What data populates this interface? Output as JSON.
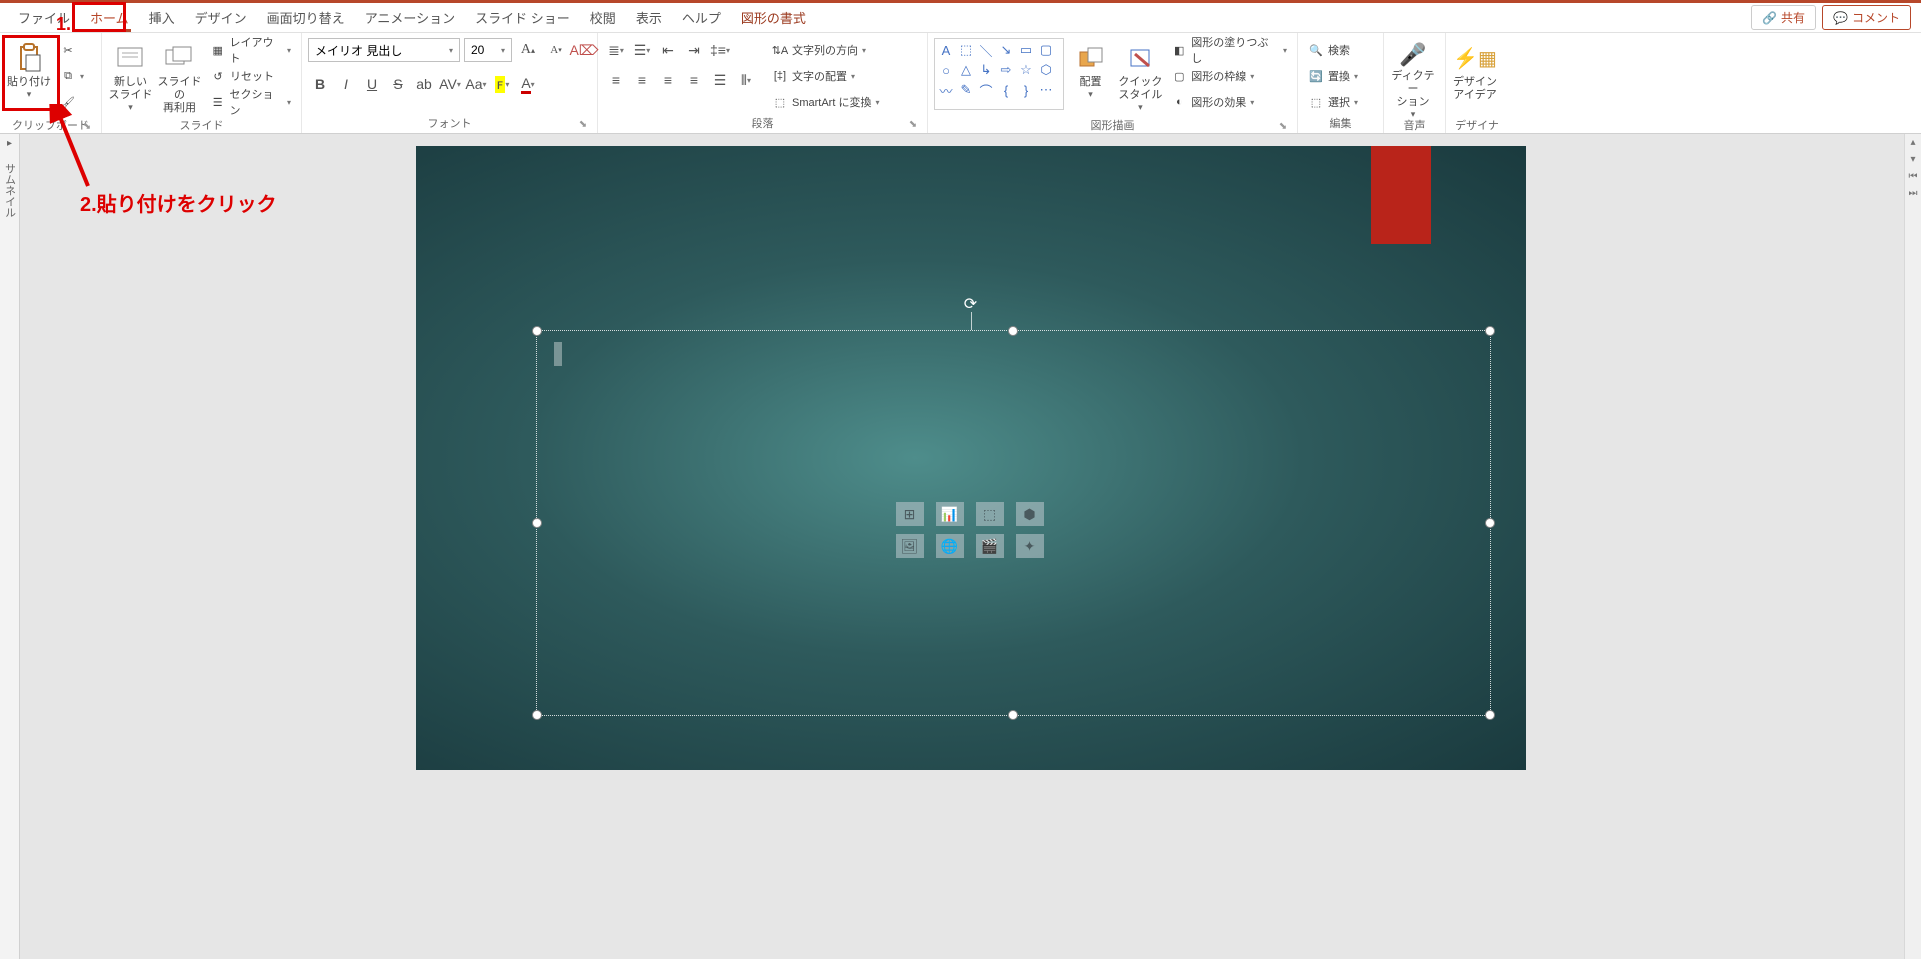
{
  "tabs": {
    "file": "ファイル",
    "home": "ホーム",
    "insert": "挿入",
    "design": "デザイン",
    "transitions": "画面切り替え",
    "animations": "アニメーション",
    "slideshow": "スライド ショー",
    "review": "校閲",
    "view": "表示",
    "help": "ヘルプ",
    "shapefmt": "図形の書式"
  },
  "titleButtons": {
    "share": "共有",
    "comment": "コメント"
  },
  "groups": {
    "clipboard": "クリップボード",
    "slides": "スライド",
    "font": "フォント",
    "paragraph": "段落",
    "drawing": "図形描画",
    "editing": "編集",
    "voice": "音声",
    "designer": "デザイナー"
  },
  "clipboard": {
    "paste": "貼り付け"
  },
  "slides": {
    "newSlide": "新しい\nスライド",
    "reuse": "スライドの\n再利用",
    "layout": "レイアウト",
    "reset": "リセット",
    "section": "セクション"
  },
  "font": {
    "name": "メイリオ 見出し",
    "size": "20"
  },
  "paragraph": {
    "textDirection": "文字列の方向",
    "alignText": "文字の配置",
    "smartart": "SmartArt に変換"
  },
  "drawing": {
    "arrange": "配置",
    "quickStyles": "クイック\nスタイル",
    "shapeFill": "図形の塗りつぶし",
    "shapeOutline": "図形の枠線",
    "shapeEffects": "図形の効果"
  },
  "editing": {
    "find": "検索",
    "replace": "置換",
    "select": "選択"
  },
  "voice": {
    "dictate": "ディクテー\nション"
  },
  "designer": {
    "ideas": "デザイン\nアイデア"
  },
  "thumb": {
    "label": "サムネイル"
  },
  "annotations": {
    "one": "1.",
    "two": "2.貼り付けをクリック"
  }
}
